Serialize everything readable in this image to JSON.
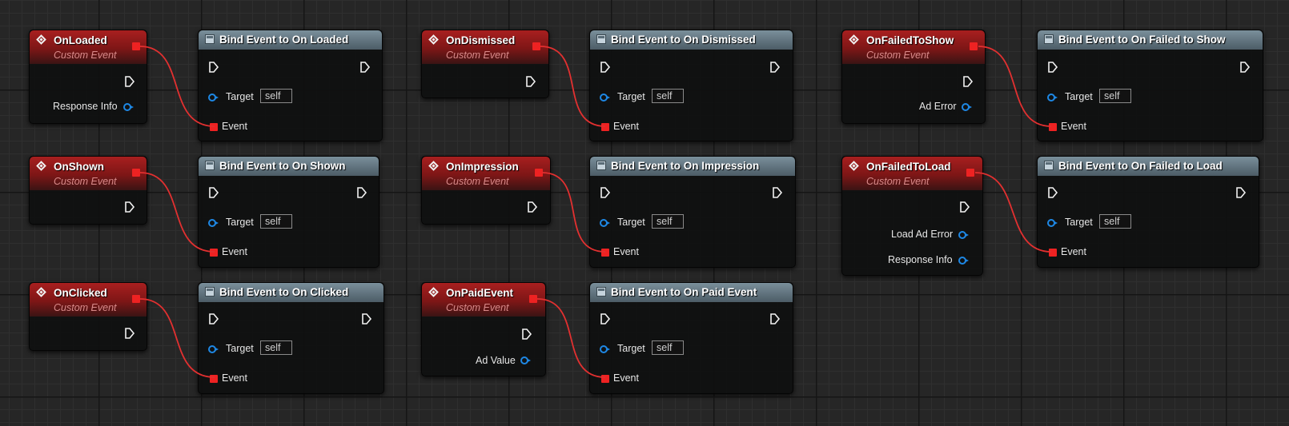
{
  "canvas": {
    "background": "#262626",
    "wire_color": "#e23030",
    "event_color": "#a81f1f",
    "function_header_color": "#66808f",
    "object_pin_color": "#1e88e5"
  },
  "events": [
    {
      "title": "OnLoaded",
      "subtitle": "Custom Event",
      "outputs": [
        "Response Info"
      ]
    },
    {
      "title": "OnShown",
      "subtitle": "Custom Event",
      "outputs": []
    },
    {
      "title": "OnClicked",
      "subtitle": "Custom Event",
      "outputs": []
    },
    {
      "title": "OnDismissed",
      "subtitle": "Custom Event",
      "outputs": []
    },
    {
      "title": "OnImpression",
      "subtitle": "Custom Event",
      "outputs": []
    },
    {
      "title": "OnPaidEvent",
      "subtitle": "Custom Event",
      "outputs": [
        "Ad Value"
      ]
    },
    {
      "title": "OnFailedToShow",
      "subtitle": "Custom Event",
      "outputs": [
        "Ad Error"
      ]
    },
    {
      "title": "OnFailedToLoad",
      "subtitle": "Custom Event",
      "outputs": [
        "Load Ad Error",
        "Response Info"
      ]
    }
  ],
  "binds": [
    {
      "title": "Bind Event to On Loaded",
      "target_label": "Target",
      "target_value": "self",
      "event_label": "Event"
    },
    {
      "title": "Bind Event to On Shown",
      "target_label": "Target",
      "target_value": "self",
      "event_label": "Event"
    },
    {
      "title": "Bind Event to On Clicked",
      "target_label": "Target",
      "target_value": "self",
      "event_label": "Event"
    },
    {
      "title": "Bind Event to On Dismissed",
      "target_label": "Target",
      "target_value": "self",
      "event_label": "Event"
    },
    {
      "title": "Bind Event to On Impression",
      "target_label": "Target",
      "target_value": "self",
      "event_label": "Event"
    },
    {
      "title": "Bind Event to On Paid Event",
      "target_label": "Target",
      "target_value": "self",
      "event_label": "Event"
    },
    {
      "title": "Bind Event to On Failed to Show",
      "target_label": "Target",
      "target_value": "self",
      "event_label": "Event"
    },
    {
      "title": "Bind Event to On Failed to Load",
      "target_label": "Target",
      "target_value": "self",
      "event_label": "Event"
    }
  ]
}
